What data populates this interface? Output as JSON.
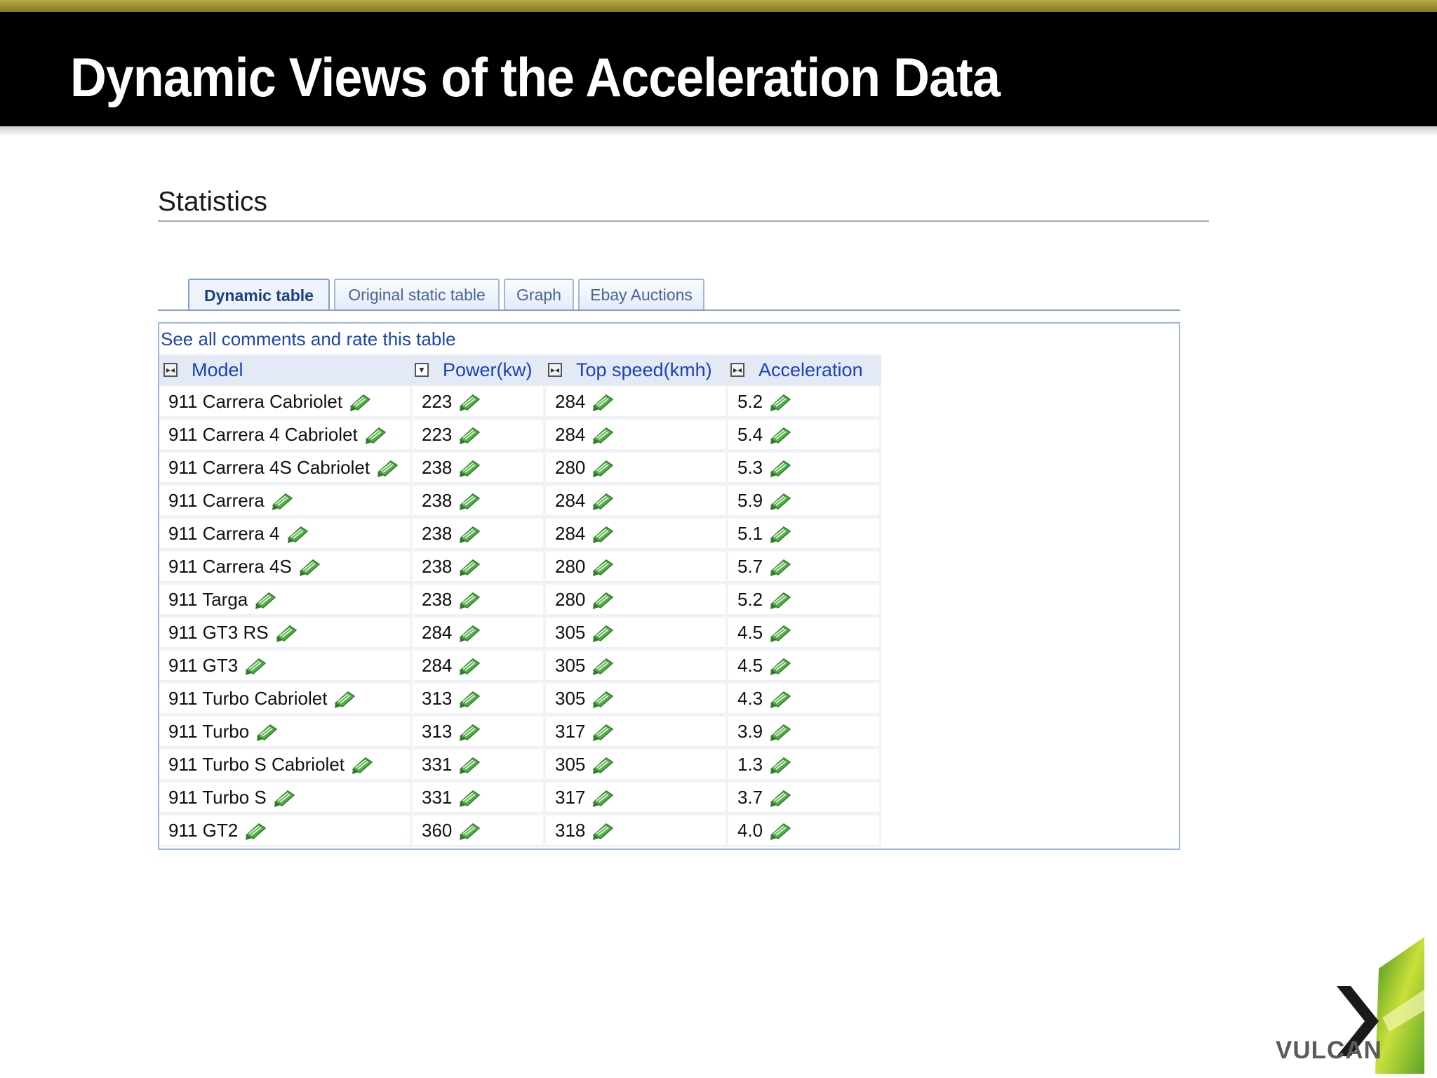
{
  "slide": {
    "title": "Dynamic Views of the Acceleration Data"
  },
  "section": {
    "heading": "Statistics"
  },
  "tabs": [
    {
      "label": "Dynamic table",
      "active": true
    },
    {
      "label": "Original static table",
      "active": false
    },
    {
      "label": "Graph",
      "active": false
    },
    {
      "label": "Ebay Auctions",
      "active": false
    }
  ],
  "comments_link": "See all comments and rate this table",
  "table": {
    "columns": [
      "Model",
      "Power(kw)",
      "Top speed(kmh)",
      "Acceleration"
    ],
    "rows": [
      [
        "911 Carrera Cabriolet",
        "223",
        "284",
        "5.2"
      ],
      [
        "911 Carrera 4 Cabriolet",
        "223",
        "284",
        "5.4"
      ],
      [
        "911 Carrera 4S Cabriolet",
        "238",
        "280",
        "5.3"
      ],
      [
        "911 Carrera",
        "238",
        "284",
        "5.9"
      ],
      [
        "911 Carrera 4",
        "238",
        "284",
        "5.1"
      ],
      [
        "911 Carrera 4S",
        "238",
        "280",
        "5.7"
      ],
      [
        "911 Targa",
        "238",
        "280",
        "5.2"
      ],
      [
        "911 GT3 RS",
        "284",
        "305",
        "4.5"
      ],
      [
        "911 GT3",
        "284",
        "305",
        "4.5"
      ],
      [
        "911 Turbo Cabriolet",
        "313",
        "305",
        "4.3"
      ],
      [
        "911 Turbo",
        "313",
        "317",
        "3.9"
      ],
      [
        "911 Turbo S Cabriolet",
        "331",
        "305",
        "1.3"
      ],
      [
        "911 Turbo S",
        "331",
        "317",
        "3.7"
      ],
      [
        "911 GT2",
        "360",
        "318",
        "4.0"
      ]
    ]
  },
  "logo": {
    "text": "VULCAN"
  },
  "colors": {
    "title_bar": "#000000",
    "accent_strip": "#9c9638",
    "link_blue": "#1a43b8",
    "tab_border": "#9db8e0",
    "comment_icon_green": "#4fae46"
  },
  "icons": {
    "sort": "sort-toggle-icon",
    "sort_desc": "sort-descending-icon",
    "comment": "comment-bubble-icon"
  }
}
